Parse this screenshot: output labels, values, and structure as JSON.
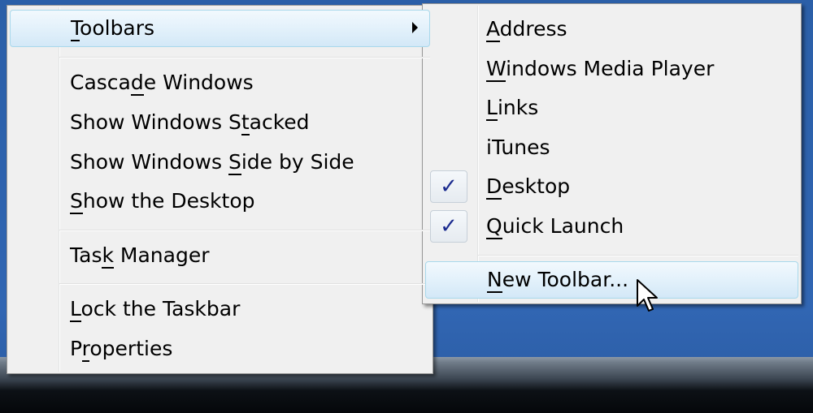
{
  "context_menu": {
    "items": [
      {
        "pre": "",
        "key": "T",
        "post": "oolbars"
      },
      {
        "pre": "Casca",
        "key": "d",
        "post": "e Windows"
      },
      {
        "pre": "Show Windows S",
        "key": "t",
        "post": "acked"
      },
      {
        "pre": "Show Windows ",
        "key": "S",
        "post": "ide by Side"
      },
      {
        "pre": "",
        "key": "S",
        "post": "how the Desktop"
      },
      {
        "pre": "Tas",
        "key": "k",
        "post": " Manager"
      },
      {
        "pre": "",
        "key": "L",
        "post": "ock the Taskbar"
      },
      {
        "pre": "P",
        "key": "r",
        "post": "operties"
      }
    ]
  },
  "toolbars_submenu": {
    "items": [
      {
        "pre": "",
        "key": "A",
        "post": "ddress",
        "checked": false
      },
      {
        "pre": "",
        "key": "W",
        "post": "indows Media Player",
        "checked": false
      },
      {
        "pre": "",
        "key": "L",
        "post": "inks",
        "checked": false
      },
      {
        "pre": "",
        "key": "",
        "post": "iTunes",
        "checked": false
      },
      {
        "pre": "",
        "key": "D",
        "post": "esktop",
        "checked": true
      },
      {
        "pre": "",
        "key": "Q",
        "post": "uick Launch",
        "checked": true
      },
      {
        "pre": "",
        "key": "N",
        "post": "ew Toolbar...",
        "checked": false
      }
    ],
    "check_glyph": "✓"
  },
  "icons": {
    "submenu_arrow": "chevron-right-icon",
    "check": "checkmark-icon",
    "cursor": "mouse-pointer-icon"
  },
  "colors": {
    "menu_background": "#f0f0f0",
    "menu_border": "#979797",
    "hover_border": "#a8d8eb",
    "hover_fill": "#e3f1fb",
    "check_color": "#1b2b8f",
    "desktop_blue": "#2d62ad"
  }
}
